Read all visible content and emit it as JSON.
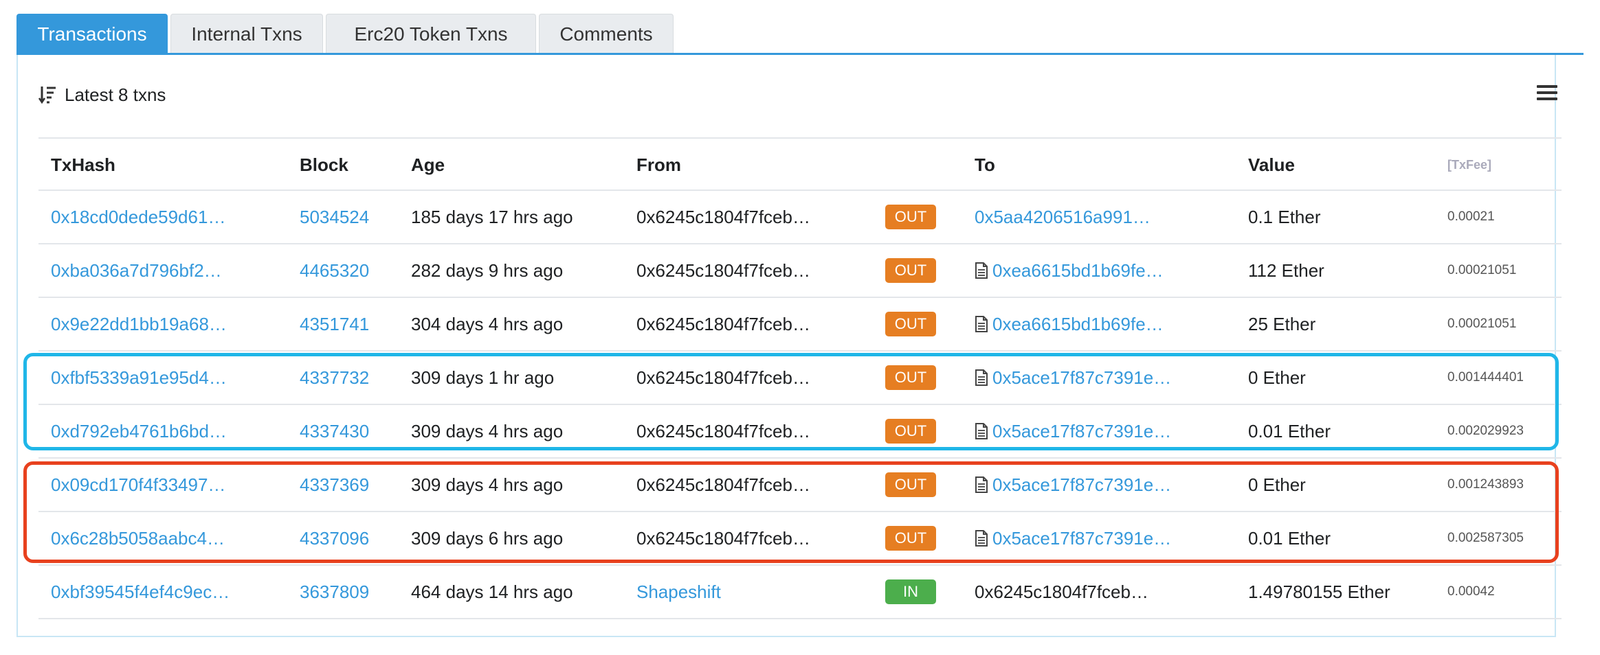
{
  "tabs": [
    {
      "label": "Transactions",
      "active": true
    },
    {
      "label": "Internal Txns",
      "active": false
    },
    {
      "label": "Erc20 Token Txns",
      "active": false
    },
    {
      "label": "Comments",
      "active": false
    }
  ],
  "summary": {
    "icon": "sort-down-icon",
    "text": "Latest 8 txns"
  },
  "menu_icon": "hamburger-menu-icon",
  "columns": {
    "txhash": "TxHash",
    "block": "Block",
    "age": "Age",
    "from": "From",
    "to": "To",
    "value": "Value",
    "txfee": "[TxFee]"
  },
  "rows": [
    {
      "txhash": "0x18cd0dede59d61…",
      "block": "5034524",
      "age": "185 days 17 hrs ago",
      "from": "0x6245c1804f7fceb…",
      "direction": "OUT",
      "to": "0x5aa4206516a991…",
      "to_contract": false,
      "value": "0.1 Ether",
      "fee": "0.00021"
    },
    {
      "txhash": "0xba036a7d796bf2…",
      "block": "4465320",
      "age": "282 days 9 hrs ago",
      "from": "0x6245c1804f7fceb…",
      "direction": "OUT",
      "to": "0xea6615bd1b69fe…",
      "to_contract": true,
      "value": "112 Ether",
      "fee": "0.00021051"
    },
    {
      "txhash": "0x9e22dd1bb19a68…",
      "block": "4351741",
      "age": "304 days 4 hrs ago",
      "from": "0x6245c1804f7fceb…",
      "direction": "OUT",
      "to": "0xea6615bd1b69fe…",
      "to_contract": true,
      "value": "25 Ether",
      "fee": "0.00021051"
    },
    {
      "txhash": "0xfbf5339a91e95d4…",
      "block": "4337732",
      "age": "309 days 1 hr ago",
      "from": "0x6245c1804f7fceb…",
      "direction": "OUT",
      "to": "0x5ace17f87c7391e…",
      "to_contract": true,
      "value": "0 Ether",
      "fee": "0.001444401"
    },
    {
      "txhash": "0xd792eb4761b6bd…",
      "block": "4337430",
      "age": "309 days 4 hrs ago",
      "from": "0x6245c1804f7fceb…",
      "direction": "OUT",
      "to": "0x5ace17f87c7391e…",
      "to_contract": true,
      "value": "0.01 Ether",
      "fee": "0.002029923"
    },
    {
      "txhash": "0x09cd170f4f33497…",
      "block": "4337369",
      "age": "309 days 4 hrs ago",
      "from": "0x6245c1804f7fceb…",
      "direction": "OUT",
      "to": "0x5ace17f87c7391e…",
      "to_contract": true,
      "value": "0 Ether",
      "fee": "0.001243893"
    },
    {
      "txhash": "0x6c28b5058aabc4…",
      "block": "4337096",
      "age": "309 days 6 hrs ago",
      "from": "0x6245c1804f7fceb…",
      "direction": "OUT",
      "to": "0x5ace17f87c7391e…",
      "to_contract": true,
      "value": "0.01 Ether",
      "fee": "0.002587305"
    },
    {
      "txhash": "0xbf39545f4ef4c9ec…",
      "block": "3637809",
      "age": "464 days 14 hrs ago",
      "from": "Shapeshift",
      "from_link": true,
      "direction": "IN",
      "to": "0x6245c1804f7fceb…",
      "to_contract": false,
      "to_plain": true,
      "value": "1.49780155 Ether",
      "fee": "0.00042"
    }
  ],
  "colors": {
    "accent": "#3498db",
    "out_badge": "#e67e22",
    "in_badge": "#4cae4c",
    "highlight_blue": "#1fb6e8",
    "highlight_red": "#e8411e"
  }
}
